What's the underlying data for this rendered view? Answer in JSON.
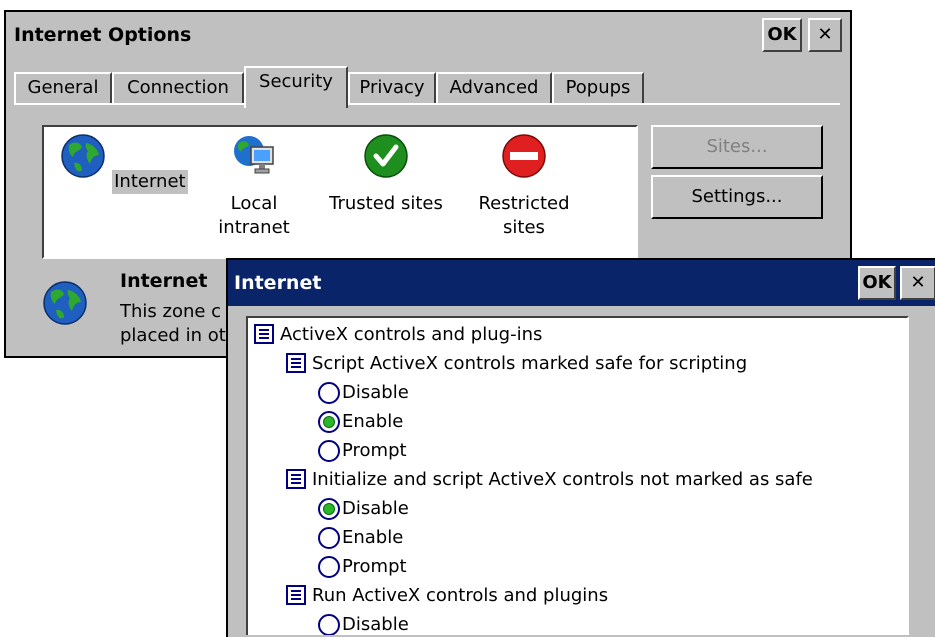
{
  "main_window": {
    "title": "Internet Options",
    "ok_label": "OK",
    "close_label": "✕",
    "tabs": [
      {
        "label": "General"
      },
      {
        "label": "Connection"
      },
      {
        "label": "Security"
      },
      {
        "label": "Privacy"
      },
      {
        "label": "Advanced"
      },
      {
        "label": "Popups"
      }
    ],
    "active_tab": "Security",
    "zones": [
      {
        "label": "Internet",
        "icon": "globe-icon"
      },
      {
        "label": "Local intranet",
        "icon": "intranet-icon"
      },
      {
        "label": "Trusted sites",
        "icon": "checkmark-icon"
      },
      {
        "label": "Restricted sites",
        "icon": "no-entry-icon"
      }
    ],
    "sites_button": "Sites...",
    "settings_button": "Settings...",
    "zone_info": {
      "title": "Internet",
      "description_line1": "This zone c",
      "description_line2": "placed in ot"
    }
  },
  "settings_dialog": {
    "title": "Internet",
    "ok_label": "OK",
    "close_label": "✕",
    "category": "ActiveX controls and plug-ins",
    "settings": [
      {
        "label": "Script ActiveX controls marked safe for scripting",
        "options": [
          "Disable",
          "Enable",
          "Prompt"
        ],
        "selected": "Enable"
      },
      {
        "label": "Initialize and script ActiveX controls not marked as safe",
        "options": [
          "Disable",
          "Enable",
          "Prompt"
        ],
        "selected": "Disable"
      },
      {
        "label": "Run ActiveX controls and plugins",
        "options": [
          "Disable"
        ],
        "selected": ""
      }
    ],
    "scroll_up": "▲",
    "scroll_down": "▼"
  },
  "colors": {
    "titlebar_active": "#0a246a",
    "window_face": "#c0c0c0",
    "radio_selected": "#2ab52a"
  }
}
